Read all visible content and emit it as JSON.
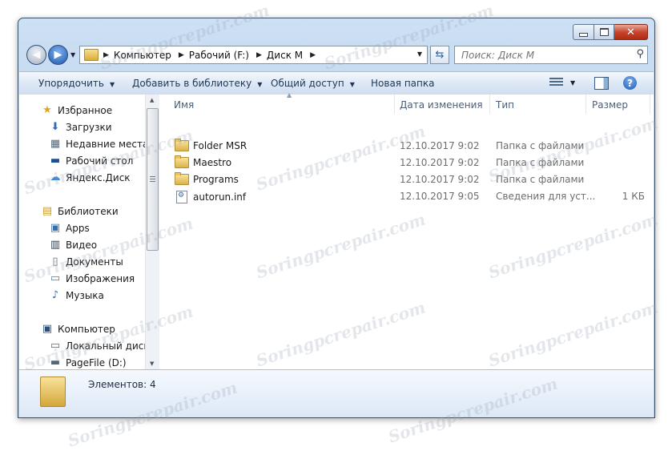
{
  "window": {
    "caption_buttons": {
      "minimize": "minimize",
      "maximize": "maximize",
      "close": "close"
    }
  },
  "navigation": {
    "breadcrumb": [
      "Компьютер",
      "Рабочий (F:)",
      "Диск M"
    ],
    "search_placeholder": "Поиск: Диск M"
  },
  "toolbar": {
    "organize": "Упорядочить",
    "add_to_library": "Добавить в библиотеку",
    "share": "Общий доступ",
    "new_folder": "Новая папка"
  },
  "nav_pane": {
    "favorites": {
      "header": "Избранное",
      "items": [
        "Загрузки",
        "Недавние места",
        "Рабочий стол",
        "Яндекс.Диск"
      ]
    },
    "libraries": {
      "header": "Библиотеки",
      "items": [
        "Apps",
        "Видео",
        "Документы",
        "Изображения",
        "Музыка"
      ]
    },
    "computer": {
      "header": "Компьютер",
      "items": [
        "Локальный диск (",
        "PageFile (D:)"
      ]
    }
  },
  "columns": {
    "name": "Имя",
    "date": "Дата изменения",
    "type": "Тип",
    "size": "Размер"
  },
  "files": [
    {
      "name": "Folder MSR",
      "date": "12.10.2017 9:02",
      "type": "Папка с файлами",
      "size": "",
      "icon": "folder-icon"
    },
    {
      "name": "Maestro",
      "date": "12.10.2017 9:02",
      "type": "Папка с файлами",
      "size": "",
      "icon": "folder-icon"
    },
    {
      "name": "Programs",
      "date": "12.10.2017 9:02",
      "type": "Папка с файлами",
      "size": "",
      "icon": "folder-icon"
    },
    {
      "name": "autorun.inf",
      "date": "12.10.2017 9:05",
      "type": "Сведения для уст...",
      "size": "1 КБ",
      "icon": "settings-file-icon"
    }
  ],
  "status": {
    "items_count": "Элементов: 4"
  },
  "watermark": "Soringpcrepair.com",
  "colors": {
    "frame": "#bcd3ec",
    "toolbar": "#dbe7f5",
    "close_button": "#c7452d"
  }
}
